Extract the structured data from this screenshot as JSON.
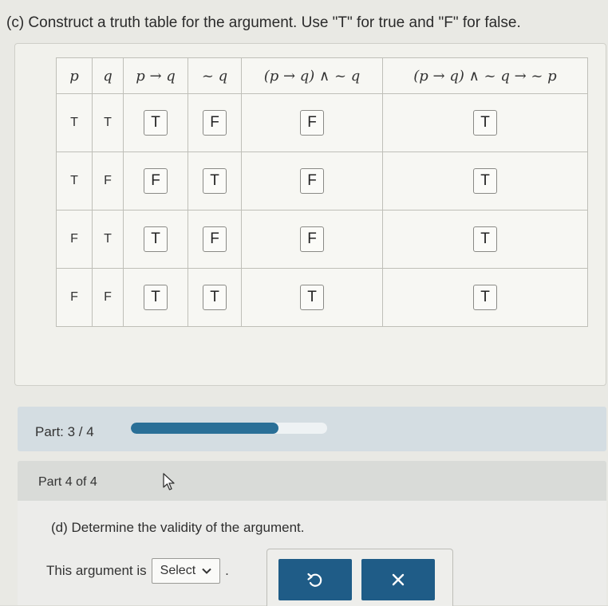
{
  "part_c": {
    "instruction": "(c) Construct a truth table for the argument. Use \"T\" for true and \"F\" for false.",
    "headers": [
      "p",
      "q",
      "p → q",
      "~ q",
      "(p → q) ∧ ~ q",
      "(p → q) ∧ ~ q → ~ p"
    ],
    "rows": [
      {
        "p": "T",
        "q": "T",
        "p_implies_q": "T",
        "not_q": "F",
        "conj": "F",
        "final": "T"
      },
      {
        "p": "T",
        "q": "F",
        "p_implies_q": "F",
        "not_q": "T",
        "conj": "F",
        "final": "T"
      },
      {
        "p": "F",
        "q": "T",
        "p_implies_q": "T",
        "not_q": "F",
        "conj": "F",
        "final": "T"
      },
      {
        "p": "F",
        "q": "F",
        "p_implies_q": "T",
        "not_q": "T",
        "conj": "T",
        "final": "T"
      }
    ]
  },
  "progress": {
    "label": "Part: 3 / 4",
    "fraction": 0.75,
    "fill_color": "#2a6f97"
  },
  "part_d": {
    "header": "Part 4 of 4",
    "question": "(d) Determine the validity of the argument.",
    "answer_prefix": "This argument is",
    "select_value": "Select",
    "period": ".",
    "undo_icon": "undo-icon",
    "clear_icon": "close-icon",
    "button_color": "#1f5c87"
  }
}
